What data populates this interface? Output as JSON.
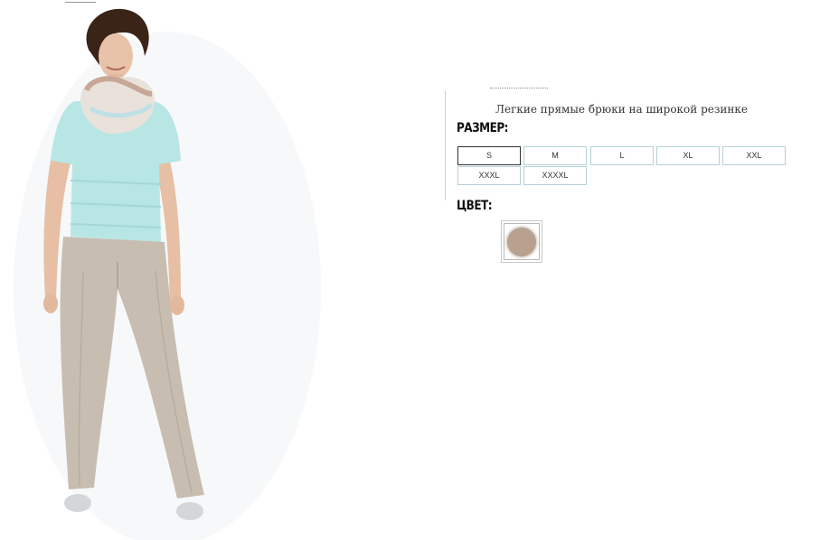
{
  "product": {
    "description": "Легкие прямые брюки на широкой резинке",
    "image_alt": "model in linen trousers"
  },
  "size_section": {
    "heading": "РАЗМЕР:",
    "options": [
      "S",
      "M",
      "L",
      "XL",
      "XXL",
      "XXXL",
      "XXXXL"
    ],
    "selected": "S"
  },
  "color_section": {
    "heading": "ЦВЕТ:",
    "swatches": [
      {
        "color": "#b9a190",
        "selected": true
      }
    ]
  },
  "colors": {
    "size_border": "#b7d1d9",
    "selected_border": "#333333",
    "swatch": "#b9a190"
  }
}
